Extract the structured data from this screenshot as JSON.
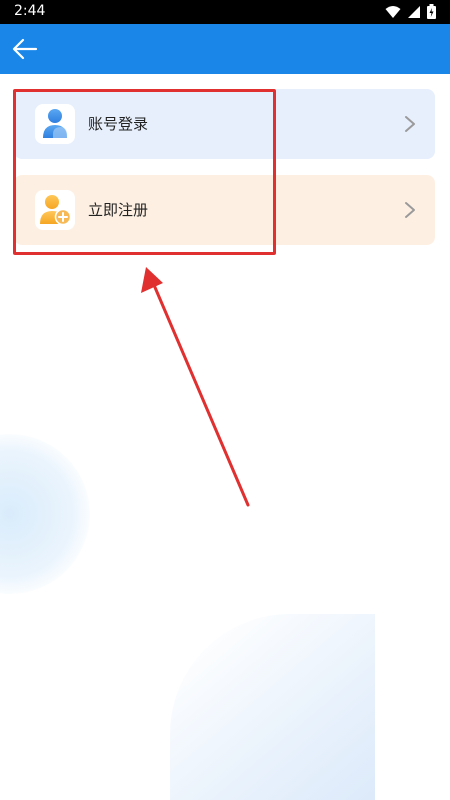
{
  "status_bar": {
    "time": "2:44",
    "icons": [
      "wifi-icon",
      "signal-icon",
      "battery-icon"
    ]
  },
  "app_bar": {
    "color": "#1a87e8",
    "back_icon": "arrow-left-icon"
  },
  "menu": {
    "items": [
      {
        "label": "账号登录",
        "icon": "user-icon",
        "background": "#e7effc"
      },
      {
        "label": "立即注册",
        "icon": "add-user-icon",
        "background": "#fdf0e3"
      }
    ]
  },
  "annotation": {
    "color": "#e03030"
  }
}
